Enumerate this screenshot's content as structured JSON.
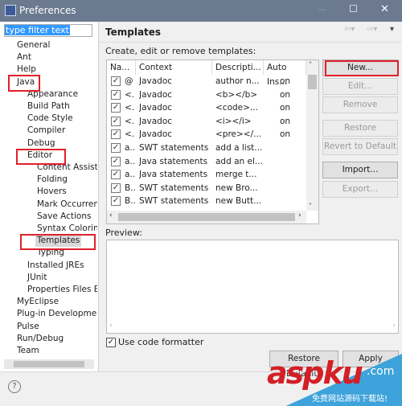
{
  "window": {
    "title": "Preferences",
    "minimize": "—",
    "maximize": "☐",
    "close": "✕"
  },
  "filter": {
    "value": "type filter text"
  },
  "tree": [
    {
      "label": "General",
      "level": 0
    },
    {
      "label": "Ant",
      "level": 0
    },
    {
      "label": "Help",
      "level": 0
    },
    {
      "label": "Java",
      "level": 0
    },
    {
      "label": "Appearance",
      "level": 1
    },
    {
      "label": "Build Path",
      "level": 1
    },
    {
      "label": "Code Style",
      "level": 1
    },
    {
      "label": "Compiler",
      "level": 1
    },
    {
      "label": "Debug",
      "level": 1
    },
    {
      "label": "Editor",
      "level": 1
    },
    {
      "label": "Content Assist",
      "level": 2
    },
    {
      "label": "Folding",
      "level": 2
    },
    {
      "label": "Hovers",
      "level": 2
    },
    {
      "label": "Mark Occurrences",
      "level": 2
    },
    {
      "label": "Save Actions",
      "level": 2
    },
    {
      "label": "Syntax Coloring",
      "level": 2
    },
    {
      "label": "Templates",
      "level": 2,
      "selected": true
    },
    {
      "label": "Typing",
      "level": 2
    },
    {
      "label": "Installed JREs",
      "level": 1
    },
    {
      "label": "JUnit",
      "level": 1
    },
    {
      "label": "Properties Files E",
      "level": 1
    },
    {
      "label": "MyEclipse",
      "level": 0
    },
    {
      "label": "Plug-in Development",
      "level": 0
    },
    {
      "label": "Pulse",
      "level": 0
    },
    {
      "label": "Run/Debug",
      "level": 0
    },
    {
      "label": "Team",
      "level": 0
    }
  ],
  "page": {
    "title": "Templates",
    "subtitle": "Create, edit or remove templates:",
    "preview_label": "Preview:",
    "use_formatter": "Use code formatter",
    "use_formatter_checked": true
  },
  "table": {
    "columns": [
      "Na...",
      "Context",
      "Descripti...",
      "Auto Ins..."
    ],
    "rows": [
      [
        "@",
        "Javadoc",
        "author n...",
        "on"
      ],
      [
        "<.",
        "Javadoc",
        "<b></b>",
        "on"
      ],
      [
        "<.",
        "Javadoc",
        "<code>...",
        "on"
      ],
      [
        "<.",
        "Javadoc",
        "<i></i>",
        "on"
      ],
      [
        "<.",
        "Javadoc",
        "<pre></...",
        "on"
      ],
      [
        "a..",
        "SWT statements",
        "add a list...",
        ""
      ],
      [
        "a..",
        "Java statements",
        "add an el...",
        ""
      ],
      [
        "a..",
        "Java statements",
        "merge t...",
        ""
      ],
      [
        "B..",
        "SWT statements",
        "new Bro...",
        ""
      ],
      [
        "B..",
        "SWT statements",
        "new Butt...",
        ""
      ]
    ]
  },
  "buttons": {
    "new": "New...",
    "edit": "Edit...",
    "remove": "Remove",
    "restore_removed": "Restore Removed",
    "revert": "Revert to Default",
    "import": "Import...",
    "export": "Export...",
    "restore_defaults": "Restore Defaults",
    "apply": "Apply"
  },
  "watermark": {
    "text": "aspku",
    "domain": ".com",
    "tagline": "免费网站源码下载站!"
  },
  "colors": {
    "titlebar": "#6b7a8f",
    "highlight": "#e0202a",
    "selection": "#3399ff"
  }
}
